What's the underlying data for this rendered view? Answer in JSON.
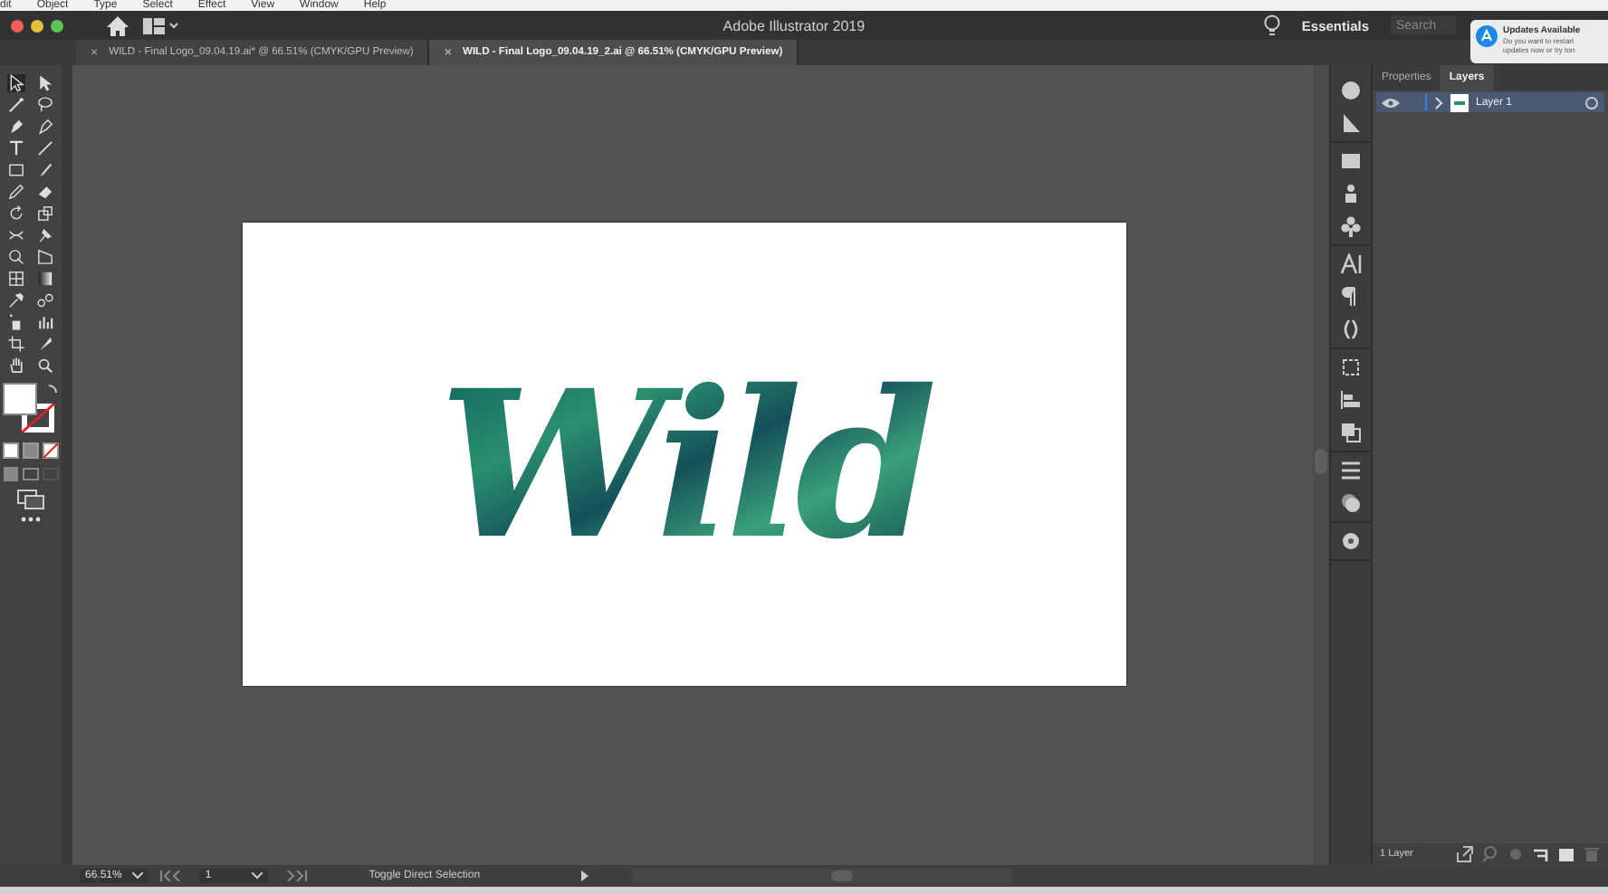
{
  "menu_bar": {
    "items": [
      "dit",
      "Object",
      "Type",
      "Select",
      "Effect",
      "View",
      "Window",
      "Help"
    ]
  },
  "window": {
    "title": "Adobe Illustrator 2019",
    "workspace": "Essentials",
    "search": {
      "placeholder": "Search"
    }
  },
  "document_tabs": [
    {
      "close": "×",
      "label": "WILD - Final Logo_09.04.19.ai* @ 66.51% (CMYK/GPU Preview)",
      "selected": false
    },
    {
      "close": "×",
      "label": "WILD - Final Logo_09.04.19_2.ai @ 66.51% (CMYK/GPU Preview)",
      "selected": true
    }
  ],
  "tools": [
    {
      "selected": true
    },
    {
      "selected": false
    },
    {
      "selected": false
    },
    {
      "selected": false
    },
    {
      "selected": false
    },
    {
      "selected": false
    },
    {
      "selected": false
    },
    {
      "selected": false
    },
    {
      "selected": false
    },
    {
      "selected": false
    },
    {
      "selected": false
    },
    {
      "selected": false
    },
    {
      "selected": false
    },
    {
      "selected": false
    },
    {
      "selected": false
    },
    {
      "selected": false
    },
    {
      "selected": false
    },
    {
      "selected": false
    },
    {
      "selected": false
    },
    {
      "selected": false
    },
    {
      "selected": false
    },
    {
      "selected": false
    },
    {
      "selected": false
    },
    {
      "selected": false
    },
    {
      "selected": false
    },
    {
      "selected": false
    },
    {
      "selected": false
    },
    {
      "selected": false
    }
  ],
  "artboard": {
    "artwork_text": "Wild"
  },
  "panel": {
    "tabs": [
      {
        "label": "Properties",
        "selected": false
      },
      {
        "label": "Layers",
        "selected": true
      }
    ],
    "layers": [
      {
        "name": "Layer 1",
        "selected": true,
        "visible": true
      }
    ],
    "footer": "1 Layer"
  },
  "notification": {
    "title": "Updates Available",
    "lines": [
      "Do you want to restart",
      "updates now or try ton"
    ]
  },
  "status_bar": {
    "zoom": "66.51%",
    "artboard": "1",
    "tool": "Toggle Direct Selection"
  }
}
